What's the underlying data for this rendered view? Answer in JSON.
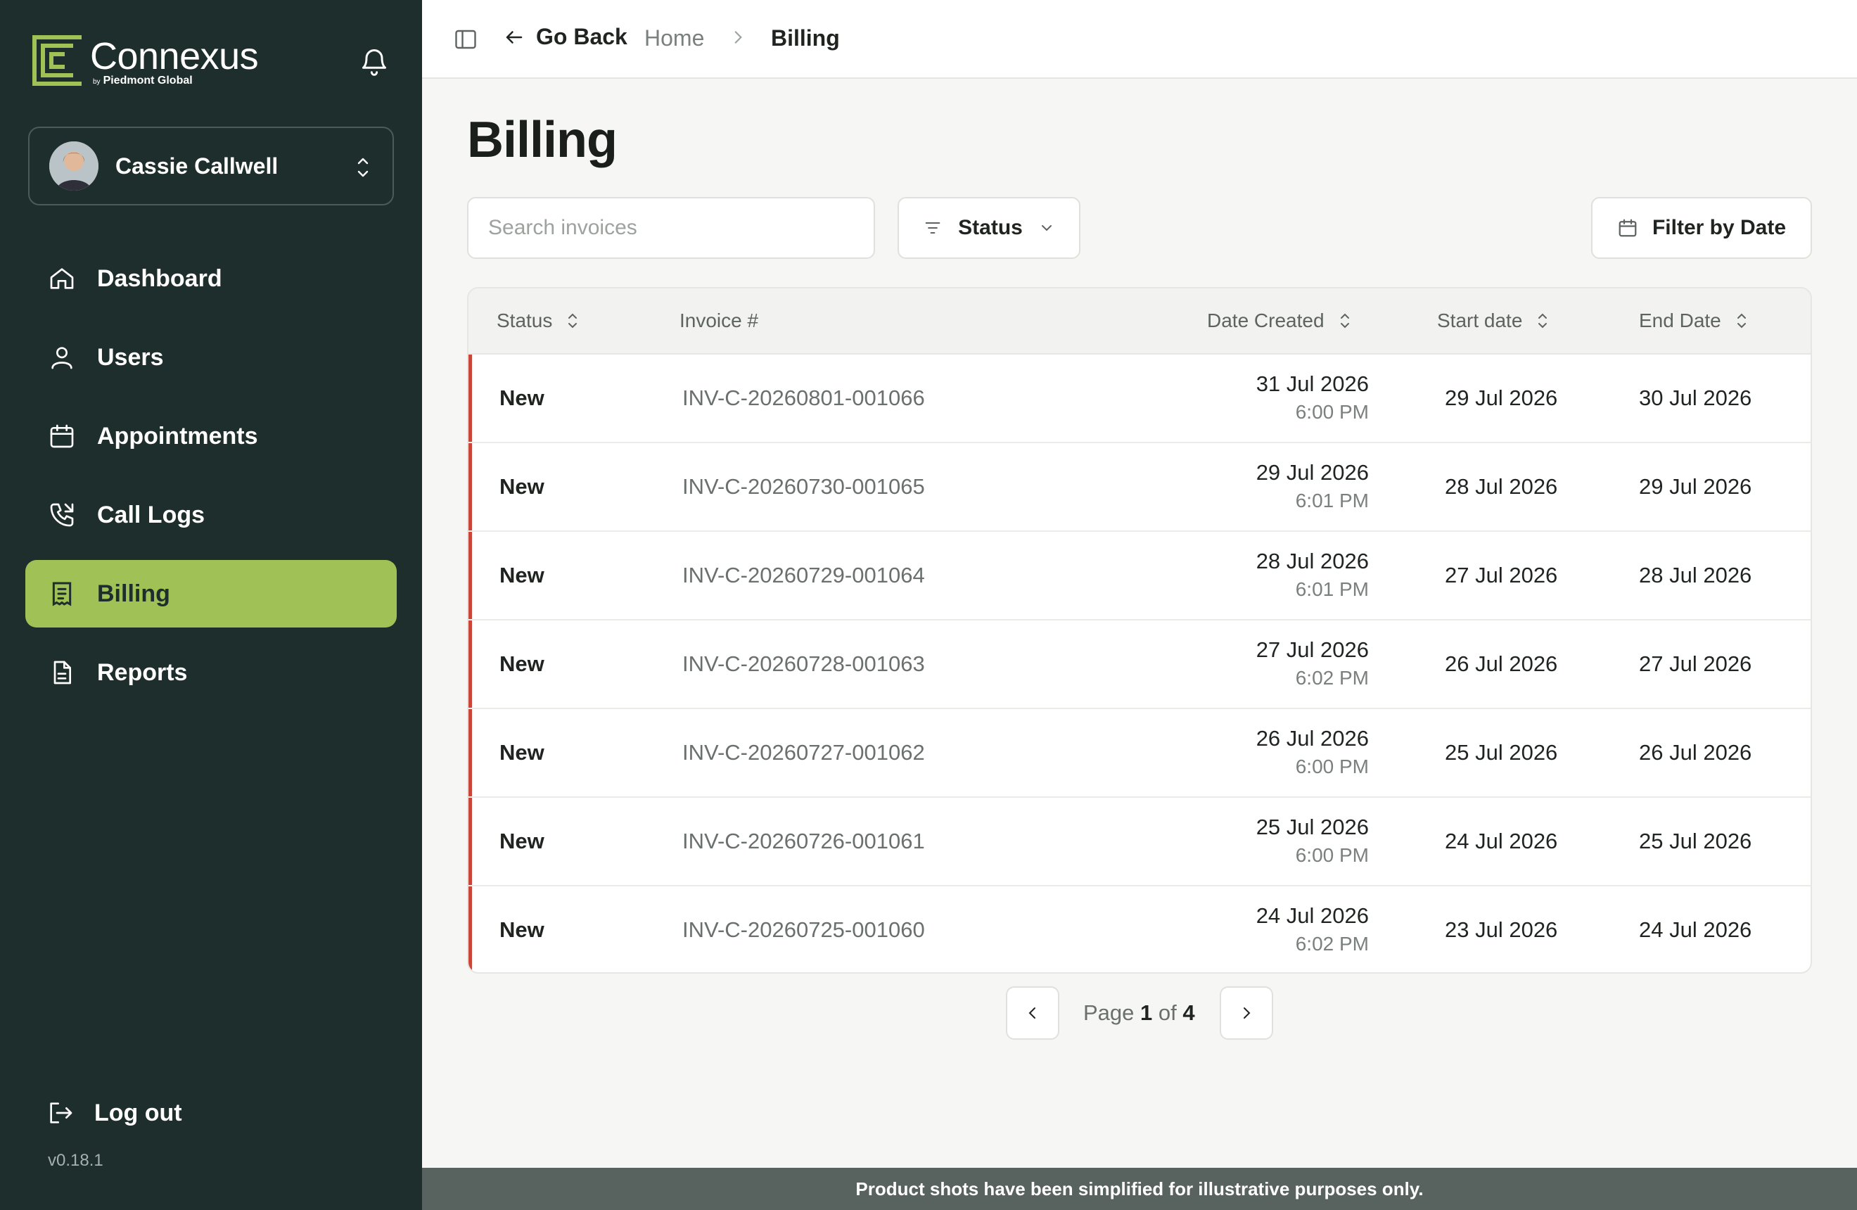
{
  "brand": {
    "name": "Connexus",
    "by": "by",
    "sub": "Piedmont Global",
    "color": "#a0c155"
  },
  "user": {
    "name": "Cassie Callwell"
  },
  "nav": [
    {
      "label": "Dashboard",
      "icon": "home-icon"
    },
    {
      "label": "Users",
      "icon": "user-icon"
    },
    {
      "label": "Appointments",
      "icon": "calendar-icon"
    },
    {
      "label": "Call Logs",
      "icon": "phone-icon"
    },
    {
      "label": "Billing",
      "icon": "receipt-icon",
      "active": true
    },
    {
      "label": "Reports",
      "icon": "document-icon"
    }
  ],
  "logout_label": "Log out",
  "version": "v0.18.1",
  "topbar": {
    "back_label": "Go Back",
    "breadcrumb_home": "Home",
    "breadcrumb_current": "Billing"
  },
  "page": {
    "title": "Billing",
    "search_placeholder": "Search invoices",
    "status_filter_label": "Status",
    "date_filter_label": "Filter by Date"
  },
  "table": {
    "columns": [
      "Status",
      "Invoice #",
      "Date Created",
      "Start date",
      "End Date"
    ],
    "rows": [
      {
        "status": "New",
        "invoice": "INV-C-20260801-001066",
        "created_date": "31 Jul 2026",
        "created_time": "6:00 PM",
        "start": "29 Jul 2026",
        "end": "30 Jul 2026"
      },
      {
        "status": "New",
        "invoice": "INV-C-20260730-001065",
        "created_date": "29 Jul 2026",
        "created_time": "6:01 PM",
        "start": "28 Jul 2026",
        "end": "29 Jul 2026"
      },
      {
        "status": "New",
        "invoice": "INV-C-20260729-001064",
        "created_date": "28 Jul 2026",
        "created_time": "6:01 PM",
        "start": "27 Jul 2026",
        "end": "28 Jul 2026"
      },
      {
        "status": "New",
        "invoice": "INV-C-20260728-001063",
        "created_date": "27 Jul 2026",
        "created_time": "6:02 PM",
        "start": "26 Jul 2026",
        "end": "27 Jul 2026"
      },
      {
        "status": "New",
        "invoice": "INV-C-20260727-001062",
        "created_date": "26 Jul 2026",
        "created_time": "6:00 PM",
        "start": "25 Jul 2026",
        "end": "26 Jul 2026"
      },
      {
        "status": "New",
        "invoice": "INV-C-20260726-001061",
        "created_date": "25 Jul 2026",
        "created_time": "6:00 PM",
        "start": "24 Jul 2026",
        "end": "25 Jul 2026"
      },
      {
        "status": "New",
        "invoice": "INV-C-20260725-001060",
        "created_date": "24 Jul 2026",
        "created_time": "6:02 PM",
        "start": "23 Jul 2026",
        "end": "24 Jul 2026"
      }
    ]
  },
  "pagination": {
    "prefix": "Page",
    "current": "1",
    "of": "of",
    "total": "4"
  },
  "footer_note": "Product shots have been simplified for illustrative purposes only.",
  "colors": {
    "sidebar_bg": "#1e2e2c",
    "active_nav": "#a0c155",
    "row_accent": "#c9463a",
    "footer_bg": "#58625f"
  }
}
